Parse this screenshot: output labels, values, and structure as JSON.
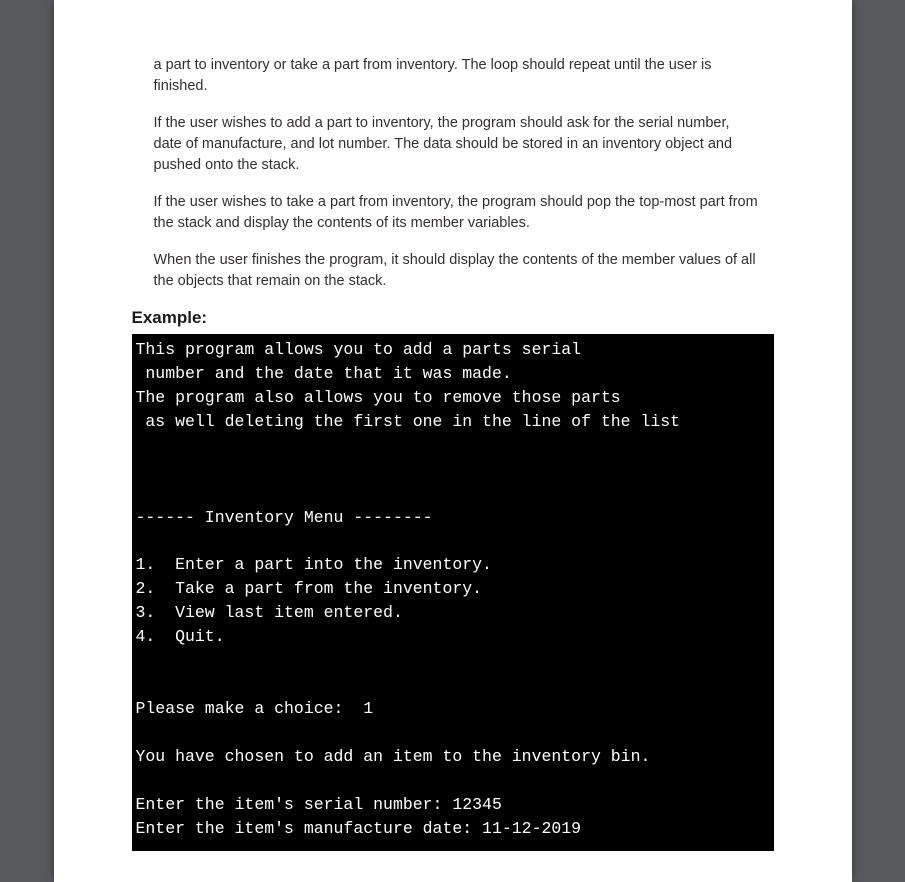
{
  "paragraphs": {
    "p1": "a part to inventory or take a part from inventory. The loop should repeat until the user is finished.",
    "p2": "If the user wishes to add a part to inventory, the program should ask for the serial number, date of manufacture, and lot number. The data should be stored in an inventory object and pushed onto the stack.",
    "p3": "If the user wishes to take a part from inventory, the program should pop the top-most part from the stack and display the contents of its member variables.",
    "p4": "When the user finishes the program, it should display the contents of the member values of all the objects that remain on the stack."
  },
  "heading": "Example:",
  "console_output": "This program allows you to add a parts serial\n number and the date that it was made.\nThe program also allows you to remove those parts\n as well deleting the first one in the line of the list\n\n\n\n------ Inventory Menu --------\n\n1.  Enter a part into the inventory.\n2.  Take a part from the inventory.\n3.  View last item entered.\n4.  Quit.\n\n\nPlease make a choice:  1\n\nYou have chosen to add an item to the inventory bin.\n\nEnter the item's serial number: 12345\nEnter the item's manufacture date: 11-12-2019"
}
